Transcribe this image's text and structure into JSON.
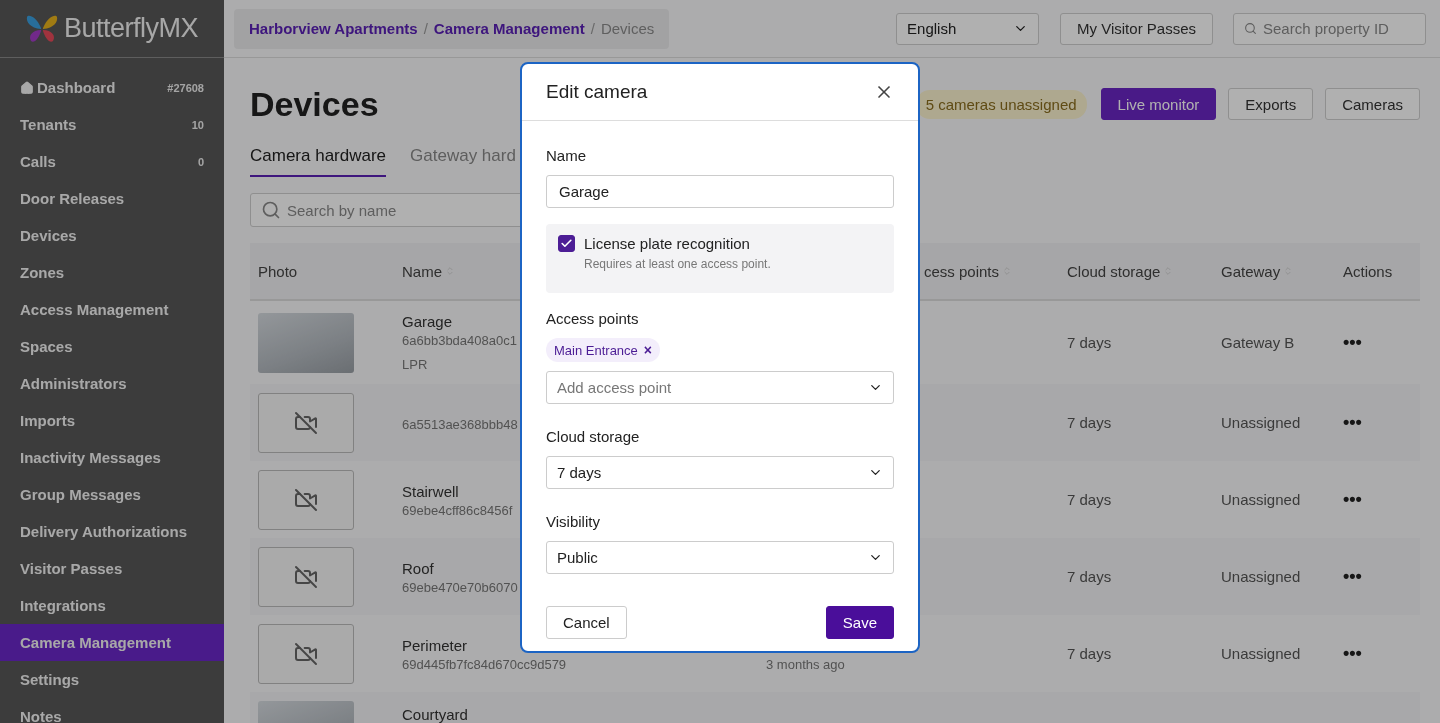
{
  "brand": {
    "name": "ButterflyMX"
  },
  "sidebar": {
    "items": [
      {
        "label": "Dashboard",
        "kind": "home",
        "badge": "#27608",
        "selected": false
      },
      {
        "label": "Tenants",
        "badge": "10",
        "selected": false
      },
      {
        "label": "Calls",
        "badge": "0",
        "selected": false
      },
      {
        "label": "Door Releases",
        "selected": false
      },
      {
        "label": "Devices",
        "selected": false
      },
      {
        "label": "Zones",
        "selected": false
      },
      {
        "label": "Access Management",
        "selected": false
      },
      {
        "label": "Spaces",
        "selected": false
      },
      {
        "label": "Administrators",
        "selected": false
      },
      {
        "label": "Imports",
        "selected": false
      },
      {
        "label": "Inactivity Messages",
        "selected": false
      },
      {
        "label": "Group Messages",
        "selected": false
      },
      {
        "label": "Delivery Authorizations",
        "selected": false
      },
      {
        "label": "Visitor Passes",
        "selected": false
      },
      {
        "label": "Integrations",
        "selected": false
      },
      {
        "label": "Camera Management",
        "selected": true
      },
      {
        "label": "Settings",
        "selected": false
      },
      {
        "label": "Notes",
        "selected": false
      }
    ]
  },
  "breadcrumb": [
    {
      "label": "Harborview Apartments",
      "kind": "link"
    },
    {
      "label": "Camera Management",
      "kind": "link",
      "separator_before": "/"
    },
    {
      "label": "Devices",
      "kind": "current",
      "separator_before": "/"
    }
  ],
  "topbar": {
    "language": "English",
    "visitor_passes_button": "My Visitor Passes",
    "search": {
      "placeholder": "Search property ID"
    }
  },
  "page": {
    "title": "Devices",
    "unassigned_badge": "5 cameras unassigned",
    "buttons": [
      {
        "label": "Live monitor",
        "kind": "primary"
      },
      {
        "label": "Exports",
        "kind": "secondary"
      },
      {
        "label": "Cameras",
        "kind": "secondary"
      }
    ]
  },
  "tabs": [
    {
      "label": "Camera hardware",
      "selected": true
    },
    {
      "label": "Gateway hard",
      "selected": false
    }
  ],
  "search": {
    "placeholder": "Search by name"
  },
  "table": {
    "columns": [
      {
        "label": "Photo",
        "sortable": false
      },
      {
        "label": "Name",
        "sortable": true
      },
      {
        "label": "cess points",
        "sortable": true
      },
      {
        "label": "Cloud storage",
        "sortable": true
      },
      {
        "label": "Gateway",
        "sortable": true
      },
      {
        "label": "Actions",
        "sortable": false
      }
    ],
    "rows": [
      {
        "kind": "photo",
        "name": "Garage",
        "id": "6a6bb3bda408a0c1",
        "tag": "LPR",
        "cloud_storage": "7 days",
        "gateway": "Gateway B",
        "actions": "•••"
      },
      {
        "kind": "no-video",
        "id": "6a5513ae368bbb48",
        "cloud_storage": "7 days",
        "gateway": "Unassigned",
        "actions": "•••"
      },
      {
        "kind": "no-video",
        "name": "Stairwell",
        "id": "69ebe4cff86c8456f",
        "cloud_storage": "7 days",
        "gateway": "Unassigned",
        "actions": "•••"
      },
      {
        "kind": "no-video",
        "name": "Roof",
        "id": "69ebe470e70b6070",
        "cloud_storage": "7 days",
        "gateway": "Unassigned",
        "actions": "•••"
      },
      {
        "kind": "no-video",
        "name": "Perimeter",
        "id": "69d445fb7fc84d670cc9d579",
        "column_3": "3 months ago",
        "cloud_storage": "7 days",
        "gateway": "Unassigned",
        "actions": "•••"
      },
      {
        "kind": "photo",
        "name": "Courtyard"
      }
    ]
  },
  "modal": {
    "title": "Edit camera",
    "name_label": "Name",
    "name_value": "Garage",
    "lpr": {
      "label": "License plate recognition",
      "hint": "Requires at least one access point.",
      "checked": true
    },
    "access_points_label": "Access points",
    "access_points": [
      "Main Entrance"
    ],
    "access_point_remove": "×",
    "access_point_placeholder": "Add access point",
    "cloud_storage_label": "Cloud storage",
    "cloud_storage_value": "7 days",
    "visibility_label": "Visibility",
    "visibility_value": "Public",
    "cancel": "Cancel",
    "save": "Save"
  }
}
